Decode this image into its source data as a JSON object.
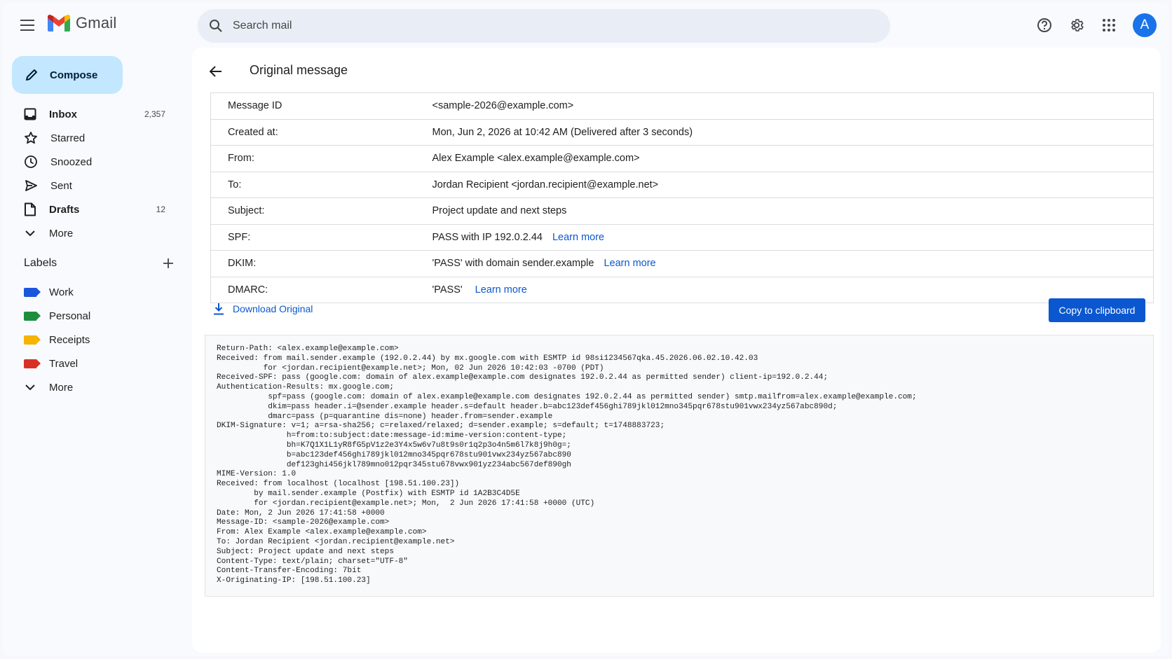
{
  "app": {
    "name": "Gmail",
    "avatar_letter": "A"
  },
  "search": {
    "placeholder": "Search mail"
  },
  "compose": {
    "label": "Compose"
  },
  "nav": [
    {
      "label": "Inbox",
      "count": "2,357",
      "bold": true,
      "icon": "inbox-icon"
    },
    {
      "label": "Starred",
      "count": "",
      "bold": false,
      "icon": "star-icon"
    },
    {
      "label": "Snoozed",
      "count": "",
      "bold": false,
      "icon": "clock-icon"
    },
    {
      "label": "Sent",
      "count": "",
      "bold": false,
      "icon": "send-icon"
    },
    {
      "label": "Drafts",
      "count": "12",
      "bold": true,
      "icon": "draft-icon"
    },
    {
      "label": "More",
      "count": "",
      "bold": false,
      "icon": "chevron-down-icon"
    }
  ],
  "labels": {
    "title": "Labels",
    "items": [
      {
        "label": "Work",
        "color": "#1a56db"
      },
      {
        "label": "Personal",
        "color": "#1e8e3e"
      },
      {
        "label": "Receipts",
        "color": "#f4b400"
      },
      {
        "label": "Travel",
        "color": "#d93025"
      }
    ],
    "more_label": "More"
  },
  "page": {
    "title": "Original message"
  },
  "details": [
    {
      "key": "Message ID",
      "value": "<sample-2026@example.com>",
      "link": ""
    },
    {
      "key": "Created at:",
      "value": "Mon, Jun 2, 2026 at 10:42 AM (Delivered after 3 seconds)",
      "link": ""
    },
    {
      "key": "From:",
      "value": "Alex Example <alex.example@example.com>",
      "link": ""
    },
    {
      "key": "To:",
      "value": "Jordan Recipient <jordan.recipient@example.net>",
      "link": ""
    },
    {
      "key": "Subject:",
      "value": "Project update and next steps",
      "link": ""
    },
    {
      "key": "SPF:",
      "value": "PASS with IP 192.0.2.44",
      "link": "Learn more"
    },
    {
      "key": "DKIM:",
      "value": "'PASS' with domain sender.example",
      "link": "Learn more"
    },
    {
      "key": "DMARC:",
      "value": "'PASS'",
      "link": "Learn more"
    }
  ],
  "actions": {
    "download_label": "Download Original",
    "copy_label": "Copy to clipboard"
  },
  "raw_source": "Return-Path: <alex.example@example.com>\nReceived: from mail.sender.example (192.0.2.44) by mx.google.com with ESMTP id 98si1234567qka.45.2026.06.02.10.42.03\n          for <jordan.recipient@example.net>; Mon, 02 Jun 2026 10:42:03 -0700 (PDT)\nReceived-SPF: pass (google.com: domain of alex.example@example.com designates 192.0.2.44 as permitted sender) client-ip=192.0.2.44;\nAuthentication-Results: mx.google.com;\n           spf=pass (google.com: domain of alex.example@example.com designates 192.0.2.44 as permitted sender) smtp.mailfrom=alex.example@example.com;\n           dkim=pass header.i=@sender.example header.s=default header.b=abc123def456ghi789jkl012mno345pqr678stu901vwx234yz567abc890d;\n           dmarc=pass (p=quarantine dis=none) header.from=sender.example\nDKIM-Signature: v=1; a=rsa-sha256; c=relaxed/relaxed; d=sender.example; s=default; t=1748883723;\n               h=from:to:subject:date:message-id:mime-version:content-type;\n               bh=K7Q1X1L1yR8fG5pV1z2e3Y4x5w6v7u8t9s0r1q2p3o4n5m6l7k8j9h0g=;\n               b=abc123def456ghi789jkl012mno345pqr678stu901vwx234yz567abc890\n               def123ghi456jkl789mno012pqr345stu678vwx901yz234abc567def890gh\nMIME-Version: 1.0\nReceived: from localhost (localhost [198.51.100.23])\n        by mail.sender.example (Postfix) with ESMTP id 1A2B3C4D5E\n        for <jordan.recipient@example.net>; Mon,  2 Jun 2026 17:41:58 +0000 (UTC)\nDate: Mon, 2 Jun 2026 17:41:58 +0000\nMessage-ID: <sample-2026@example.com>\nFrom: Alex Example <alex.example@example.com>\nTo: Jordan Recipient <jordan.recipient@example.net>\nSubject: Project update and next steps\nContent-Type: text/plain; charset=\"UTF-8\"\nContent-Transfer-Encoding: 7bit\nX-Originating-IP: [198.51.100.23]"
}
